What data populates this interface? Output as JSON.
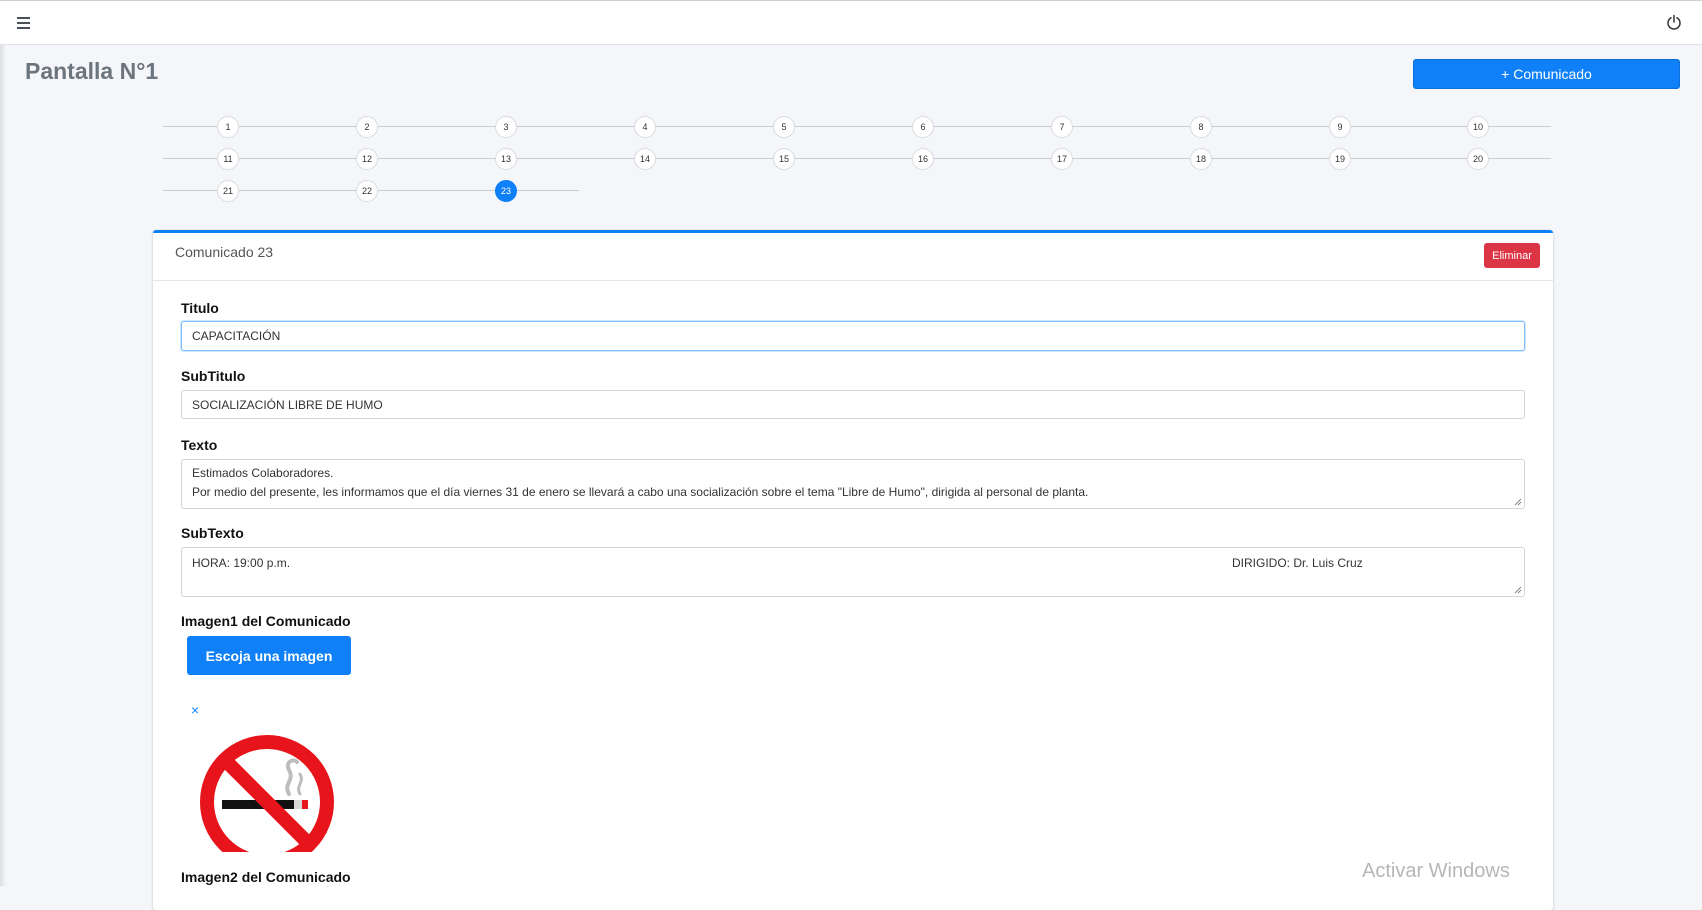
{
  "header": {
    "menu_icon": "hamburger-icon",
    "power_icon": "power-icon"
  },
  "page": {
    "title": "Pantalla N°1",
    "add_button": "+ Comunicado"
  },
  "stepper": {
    "steps": [
      "1",
      "2",
      "3",
      "4",
      "5",
      "6",
      "7",
      "8",
      "9",
      "10",
      "11",
      "12",
      "13",
      "14",
      "15",
      "16",
      "17",
      "18",
      "19",
      "20",
      "21",
      "22",
      "23"
    ],
    "active": "23"
  },
  "card": {
    "title": "Comunicado 23",
    "delete_button": "Eliminar",
    "titulo_label": "Titulo",
    "titulo_value": "CAPACITACIÓN",
    "subtitulo_label": "SubTitulo",
    "subtitulo_value": "SOCIALIZACIÓN LIBRE DE HUMO",
    "texto_label": "Texto",
    "texto_line1": "Estimados Colaboradores.",
    "texto_line2": "Por medio del presente, les informamos que el día viernes 31 de enero se llevará a cabo una socialización sobre el tema \"Libre de Humo\", dirigida al personal de planta.",
    "subtexto_label": "SubTexto",
    "subtexto_left": "HORA: 19:00 p.m.",
    "subtexto_right": "DIRIGIDO: Dr. Luis Cruz",
    "imagen1_label": "Imagen1 del Comunicado",
    "choose_image_button": "Escoja una imagen",
    "remove_image": "×",
    "imagen2_label": "Imagen2 del Comunicado"
  },
  "watermark": "Activar Windows",
  "colors": {
    "primary": "#0f80f7",
    "danger": "#dc3545",
    "background": "#f4f6f9"
  }
}
